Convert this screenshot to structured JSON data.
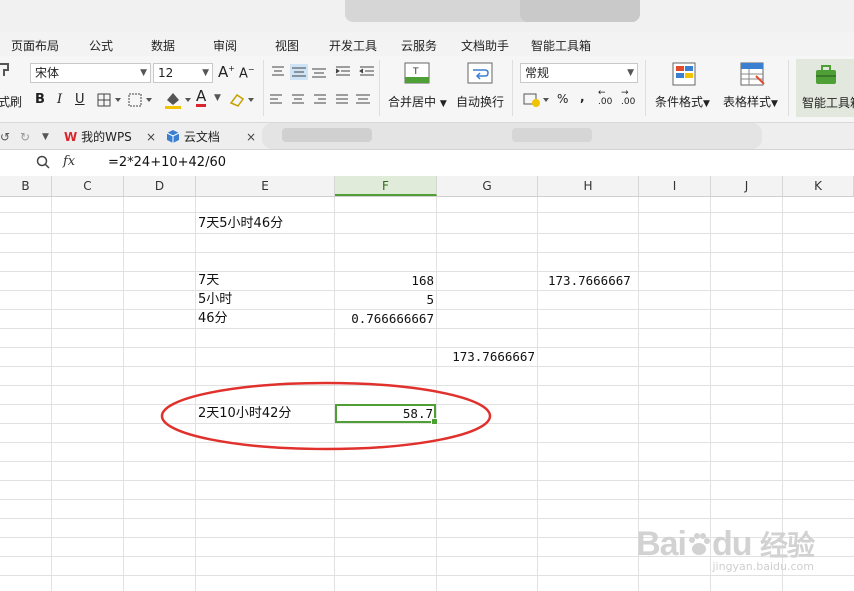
{
  "menu": [
    "页面布局",
    "公式",
    "数据",
    "审阅",
    "视图",
    "开发工具",
    "云服务",
    "文档助手",
    "智能工具箱"
  ],
  "ribbon": {
    "font_name": "宋体",
    "font_size": "12",
    "format_brush_partial": "式刷",
    "bold": "B",
    "italic": "I",
    "underline": "U",
    "merge_center": "合并居中",
    "wrap_text": "自动换行",
    "number_format": "常规",
    "percent": "%",
    "comma": ",",
    "inc_decimal": ".00",
    "dec_decimal": ".00",
    "cond_format": "条件格式",
    "table_style": "表格样式",
    "smart_toolbox": "智能工具箱",
    "grow_font": "A",
    "shrink_font": "A",
    "font_color_letter": "A"
  },
  "tabs": [
    {
      "label": "我的WPS",
      "close": "×"
    },
    {
      "label": "云文档",
      "close": "×"
    }
  ],
  "formula_bar": {
    "fx": "fx",
    "formula": "=2*24+10+42/60"
  },
  "columns": [
    "B",
    "C",
    "D",
    "E",
    "F",
    "G",
    "H",
    "I",
    "J",
    "K"
  ],
  "cells": {
    "e_title": "7天5小时46分",
    "e_days": "7天",
    "f_days": "168",
    "h_total": "173.7666667",
    "e_hours": "5小时",
    "f_hours": "5",
    "e_minutes": "46分",
    "f_minutes": "0.766666667",
    "g_total": "173.7666667",
    "e_example": "2天10小时42分",
    "f_example": "58.7"
  },
  "watermark": {
    "brand": "Bai",
    "brand2": "du",
    "cn": "经验",
    "url": "jingyan.baidu.com"
  },
  "colors": {
    "accent_green": "#4f9f37",
    "annotation_red": "#e0312d",
    "wps_red": "#d9252b"
  }
}
